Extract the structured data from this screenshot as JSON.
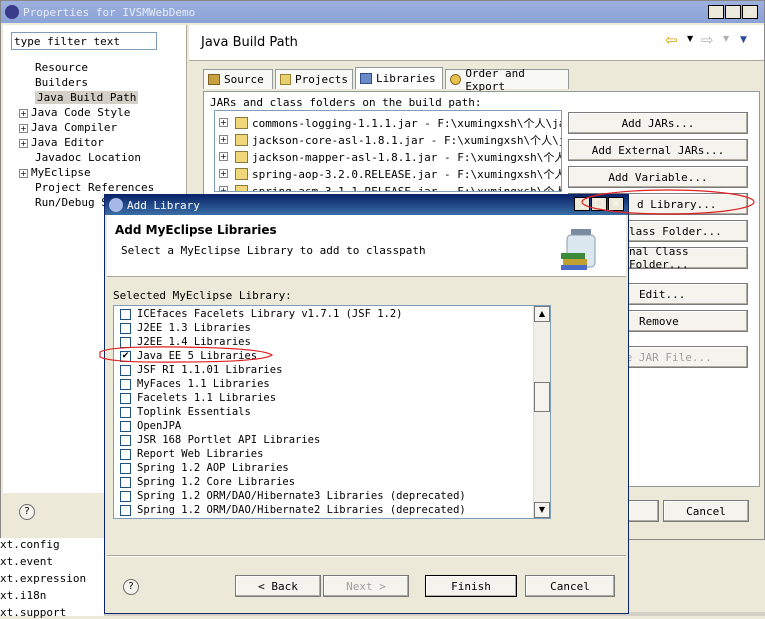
{
  "props_window": {
    "title": "Properties for IVSMWebDemo",
    "filter_value": "type filter text",
    "tree": [
      {
        "label": "Resource",
        "expandable": false
      },
      {
        "label": "Builders",
        "expandable": false
      },
      {
        "label": "Java Build Path",
        "expandable": false,
        "selected": true
      },
      {
        "label": "Java Code Style",
        "expandable": true
      },
      {
        "label": "Java Compiler",
        "expandable": true
      },
      {
        "label": "Java Editor",
        "expandable": true
      },
      {
        "label": "Javadoc Location",
        "expandable": false
      },
      {
        "label": "MyEclipse",
        "expandable": true
      },
      {
        "label": "Project References",
        "expandable": false
      },
      {
        "label": "Run/Debug Se",
        "expandable": false
      }
    ],
    "page_title": "Java Build Path",
    "tabs": [
      {
        "label": "Source",
        "active": false
      },
      {
        "label": "Projects",
        "active": false
      },
      {
        "label": "Libraries",
        "active": true
      },
      {
        "label": "Order and Export",
        "active": false
      }
    ],
    "jars_label": "JARs and class folders on the build path:",
    "jars": [
      "commons-logging-1.1.1.jar - F:\\xumingxsh\\个人\\javaT",
      "jackson-core-asl-1.8.1.jar - F:\\xumingxsh\\个人\\java",
      "jackson-mapper-asl-1.8.1.jar - F:\\xumingxsh\\个人\\ja",
      "spring-aop-3.2.0.RELEASE.jar - F:\\xumingxsh\\个人\\ja",
      "spring-asm-3.1.1.RELEASE.jar - F:\\xumingxsh\\个人\\ja"
    ],
    "buttons": {
      "add_jars": "Add JARs...",
      "add_external_jars": "Add External JARs...",
      "add_variable": "Add Variable...",
      "add_library": "d Library...",
      "add_class_folder": "lass Folder...",
      "external_class_folder": "nal Class Folder...",
      "edit": "Edit...",
      "remove": "Remove",
      "migrate": "te JAR File...",
      "cancel": "Cancel"
    },
    "icon_arrow": "⇦"
  },
  "bg_list": [
    "xt.config",
    "xt.event",
    "xt.expression",
    "xt.i18n",
    "xt.support"
  ],
  "dialog": {
    "title": "Add Library",
    "heading": "Add MyEclipse Libraries",
    "subheading": "Select a MyEclipse Library to add to classpath",
    "list_label": "Selected MyEclipse Library:",
    "libraries": [
      {
        "label": "ICEfaces Facelets Library v1.7.1 (JSF 1.2)",
        "checked": false
      },
      {
        "label": "J2EE 1.3 Libraries",
        "checked": false
      },
      {
        "label": "J2EE 1.4 Libraries",
        "checked": false
      },
      {
        "label": "Java EE 5 Libraries",
        "checked": true
      },
      {
        "label": "JSF RI 1.1.01 Libraries",
        "checked": false
      },
      {
        "label": "MyFaces 1.1 Libraries",
        "checked": false
      },
      {
        "label": "Facelets 1.1 Libraries",
        "checked": false
      },
      {
        "label": "Toplink Essentials",
        "checked": false
      },
      {
        "label": "OpenJPA",
        "checked": false
      },
      {
        "label": "JSR 168 Portlet API Libraries",
        "checked": false
      },
      {
        "label": "Report Web Libraries",
        "checked": false
      },
      {
        "label": "Spring 1.2 AOP Libraries",
        "checked": false
      },
      {
        "label": "Spring 1.2 Core Libraries",
        "checked": false
      },
      {
        "label": "Spring 1.2 ORM/DAO/Hibernate3 Libraries (deprecated)",
        "checked": false
      },
      {
        "label": "Spring 1.2 ORM/DAO/Hibernate2 Libraries (deprecated)",
        "checked": false
      }
    ],
    "buttons": {
      "back": "< Back",
      "next": "Next >",
      "finish": "Finish",
      "cancel": "Cancel"
    },
    "check_mark": "✔",
    "help_mark": "?"
  },
  "colors": {
    "title_active": "#0a246a",
    "title_inactive": "#7a96df",
    "annotation": "#e02020"
  }
}
